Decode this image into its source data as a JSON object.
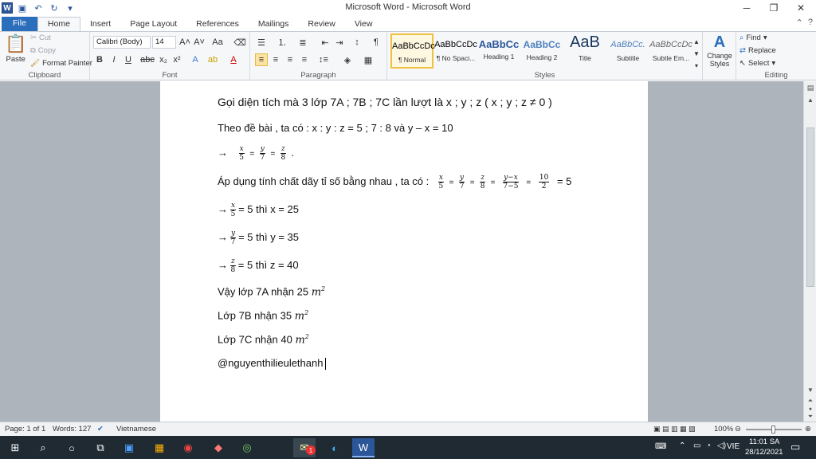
{
  "window": {
    "title": "Microsoft Word - Microsoft Word"
  },
  "tabs": [
    "File",
    "Home",
    "Insert",
    "Page Layout",
    "References",
    "Mailings",
    "Review",
    "View"
  ],
  "clipboard": {
    "paste": "Paste",
    "cut": "Cut",
    "copy": "Copy",
    "format_painter": "Format Painter",
    "label": "Clipboard"
  },
  "font": {
    "name": "Calibri (Body)",
    "size": "14",
    "label": "Font"
  },
  "paragraph": {
    "label": "Paragraph"
  },
  "styles": {
    "items": [
      {
        "preview": "AaBbCcDc",
        "name": "¶ Normal"
      },
      {
        "preview": "AaBbCcDc",
        "name": "¶ No Spaci..."
      },
      {
        "preview": "AaBbCc",
        "name": "Heading 1"
      },
      {
        "preview": "AaBbCc",
        "name": "Heading 2"
      },
      {
        "preview": "AaB",
        "name": "Title"
      },
      {
        "preview": "AaBbCc.",
        "name": "Subtitle"
      },
      {
        "preview": "AaBbCcDc",
        "name": "Subtle Em..."
      }
    ],
    "change_styles": "Change Styles",
    "label": "Styles"
  },
  "editing": {
    "find": "Find",
    "replace": "Replace",
    "select": "Select",
    "label": "Editing"
  },
  "doc": {
    "l1": "Gọi diện tích mà 3 lớp 7A ; 7B ; 7C lần lượt là x ; y ; z ( x ; y ; z ≠ 0 )",
    "l2": "Theo đề bài , ta có : x : y : z = 5 ; 7 : 8 và y – x = 10",
    "l3_arrow": "→",
    "l4_text": "Áp dụng tính chất dãy tỉ số bằng nhau , ta có :",
    "l4_result": "= 5",
    "l5": "= 5 thì x = 25",
    "l6": "= 5 thì y = 35",
    "l7": "= 5 thì z = 40",
    "l8": "Vậy lớp 7A nhận 25",
    "l9": "Lớp 7B nhận 35",
    "l10": "Lớp 7C nhận 40",
    "l11": "@nguyenthilieulethanh",
    "unit": "m",
    "unit_exp": "2"
  },
  "status": {
    "page": "Page: 1 of 1",
    "words": "Words: 127",
    "language": "Vietnamese",
    "zoom": "100%"
  },
  "taskbar": {
    "lang": "VIE",
    "time": "11:01 SA",
    "date": "28/12/2021",
    "badge": "1"
  }
}
